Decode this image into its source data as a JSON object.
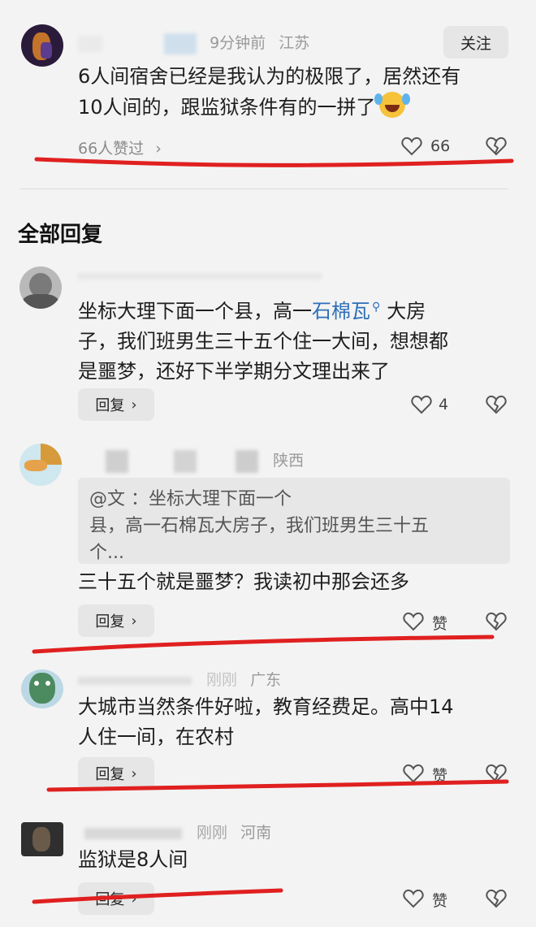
{
  "top_comment": {
    "meta_time": "9分钟前",
    "meta_location": "江苏",
    "follow_label": "关注",
    "text_line1": "6人间宿舍已经是我认为的极限了，居然还有",
    "text_line2": "10人间的，跟监狱条件有的一拼了",
    "liked_by": "66人赞过",
    "like_count": "66"
  },
  "section_title": "全部回复",
  "replies": [
    {
      "text_pre": "坐标大理下面一个县，高一",
      "text_link": "石棉瓦",
      "text_post1": "大房",
      "text_line2": "子，我们班男生三十五个住一大间，想想都",
      "text_line3": "是噩梦，还好下半学期分文理出来了",
      "reply_label": "回复",
      "like_count": "4"
    },
    {
      "meta_location": "陕西",
      "quote_line1": "@文   ：坐标大理下面一个",
      "quote_line2": "县，高一石棉瓦大房子，我们班男生三十五",
      "quote_line3": "个...",
      "text": "三十五个就是噩梦？我读初中那会还多",
      "reply_label": "回复",
      "like_label": "赞"
    },
    {
      "meta_time": "刚刚",
      "meta_location": "广东",
      "text_line1": "大城市当然条件好啦，教育经费足。高中14",
      "text_line2": "人住一间，在农村",
      "reply_label": "回复",
      "like_label": "赞"
    },
    {
      "meta_time": "刚刚",
      "meta_location": "河南",
      "text": "监狱是8人间",
      "reply_label": "回复",
      "like_label": "赞"
    }
  ],
  "colors": {
    "annotation_red": "#e02020",
    "link_blue": "#2d6fb8"
  }
}
